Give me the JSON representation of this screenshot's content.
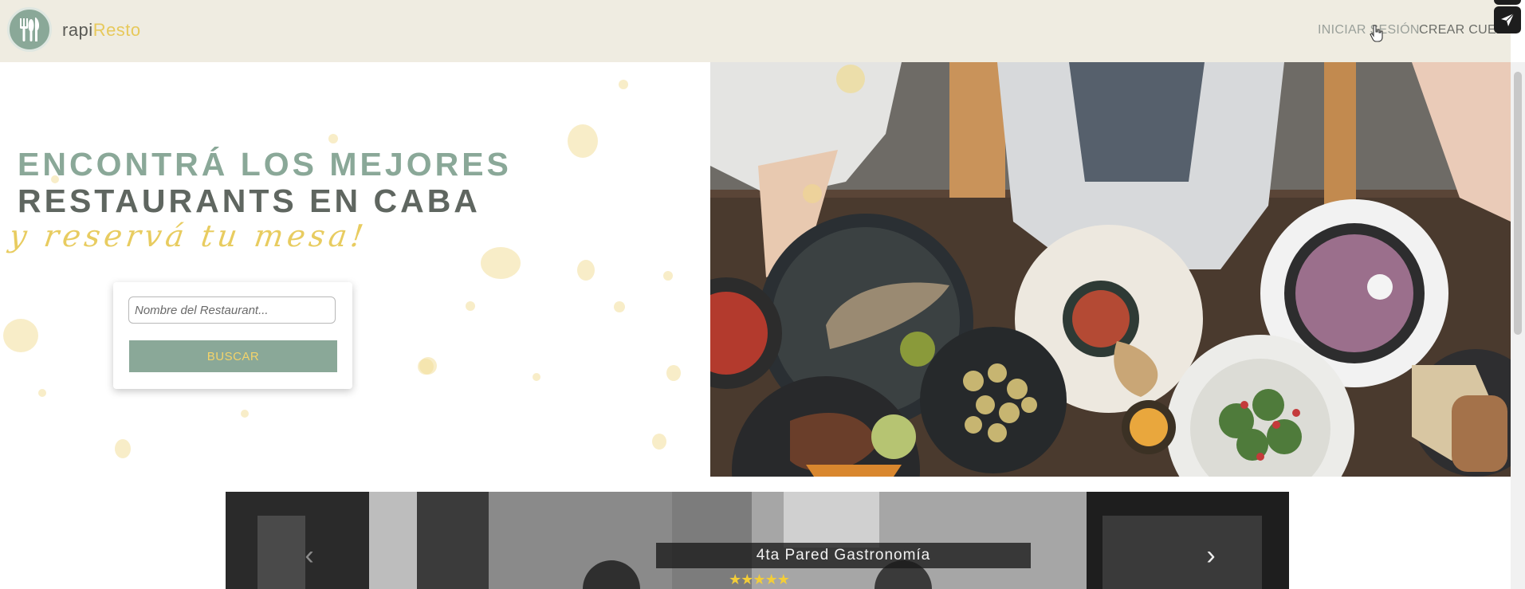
{
  "header": {
    "brand_prefix": "rapi",
    "brand_suffix": "Resto",
    "login_label": "INICIAR SESIÓN",
    "signup_label": "CREAR CUEN",
    "icons": [
      "logo-cutlery-icon",
      "pointer-cursor-icon",
      "send-icon"
    ]
  },
  "hero": {
    "headline_line1": "ENCONTRÁ LOS MEJORES",
    "headline_line2": "RESTAURANTS EN CABA",
    "tagline": "y reservá tu mesa!",
    "search": {
      "placeholder": "Nombre del Restaurant...",
      "value": "",
      "button_label": "BUSCAR"
    }
  },
  "carousel": {
    "current_title": "4ta Pared Gastronomía",
    "rating_stars": "★★★★★",
    "rating_value": 5,
    "prev_icon": "chevron-left-icon",
    "next_icon": "chevron-right-icon"
  },
  "colors": {
    "sage": "#8aa898",
    "gold": "#e8cc60",
    "header_bg": "#efece1",
    "dark_text": "#5f6660"
  }
}
